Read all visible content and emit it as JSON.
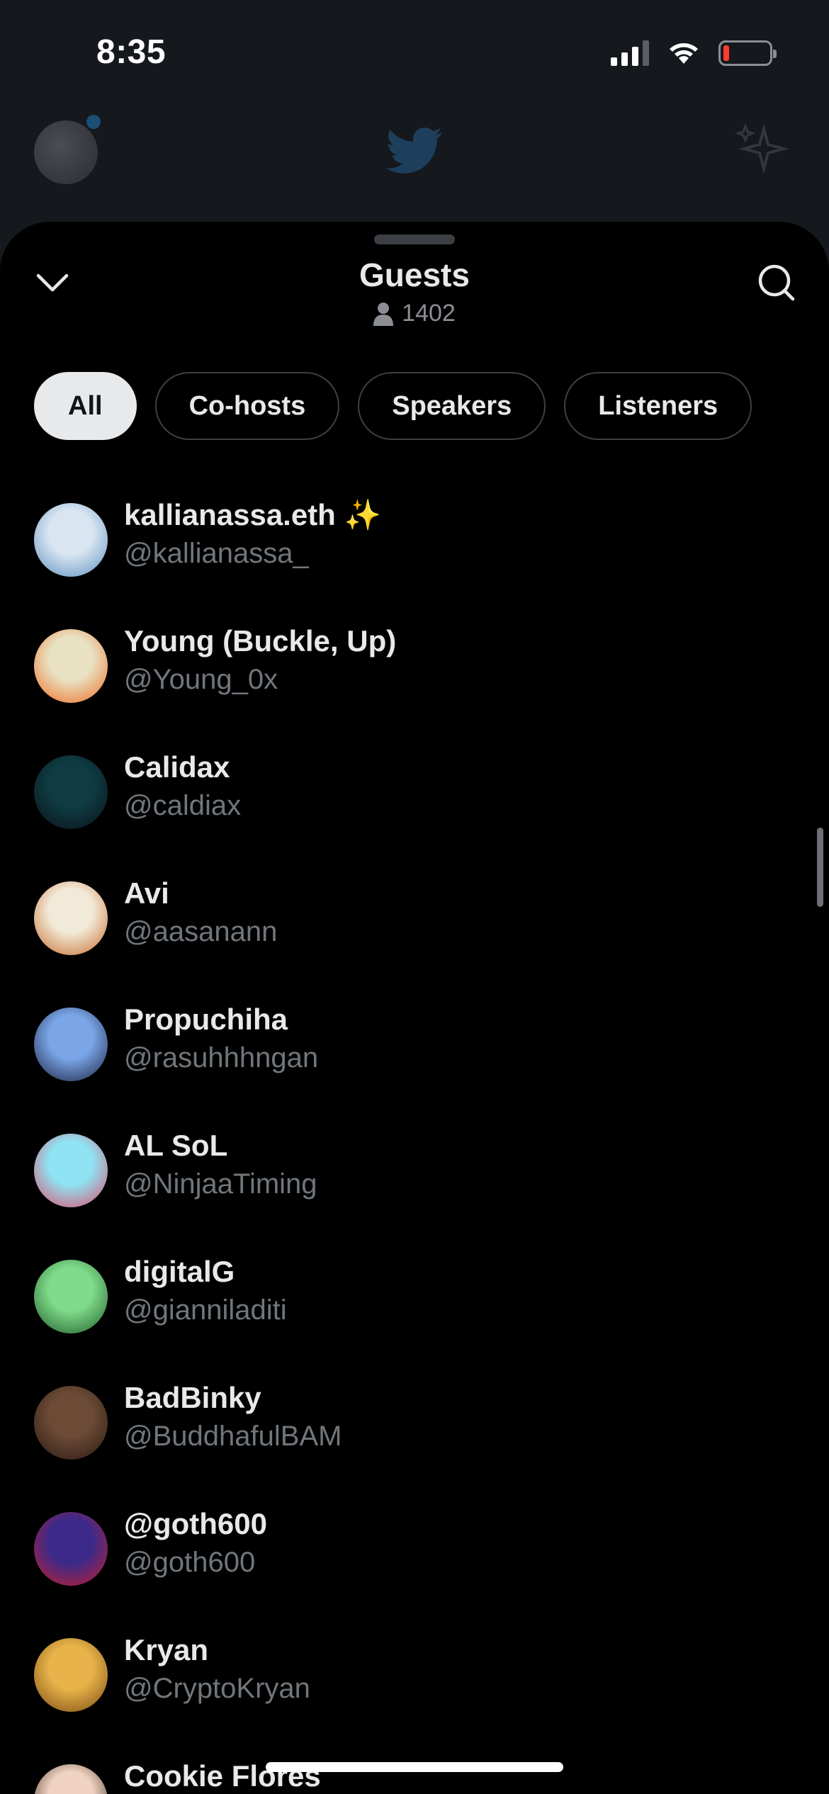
{
  "status_bar": {
    "time": "8:35",
    "icons": [
      "cellular-signal-icon",
      "wifi-icon",
      "battery-low-icon"
    ],
    "battery_color": "#ff3b30"
  },
  "background_header": {
    "icons": [
      "profile-avatar",
      "twitter-bird-icon",
      "sparkle-icon"
    ],
    "accent_color": "#1d9bf0"
  },
  "sheet": {
    "title": "Guests",
    "guest_count": "1402",
    "icons": [
      "chevron-down-icon",
      "search-icon",
      "person-icon"
    ]
  },
  "tabs": [
    {
      "label": "All",
      "active": true
    },
    {
      "label": "Co-hosts",
      "active": false
    },
    {
      "label": "Speakers",
      "active": false
    },
    {
      "label": "Listeners",
      "active": false
    }
  ],
  "guests": [
    {
      "name": "kallianassa.eth",
      "badge": "✨",
      "handle": "@kallianassa_",
      "avatar_colors": [
        "#d9e6f2",
        "#5d8fbf"
      ]
    },
    {
      "name": "Young (Buckle, Up)",
      "handle": "@Young_0x",
      "avatar_colors": [
        "#e8e1c2",
        "#f06a1e"
      ]
    },
    {
      "name": "Calidax",
      "handle": "@caldiax",
      "avatar_colors": [
        "#0f3c44",
        "#0a1216"
      ]
    },
    {
      "name": "Avi",
      "handle": "@aasanann",
      "avatar_colors": [
        "#f2ead8",
        "#c66a2b"
      ]
    },
    {
      "name": "Propuchiha",
      "handle": "@rasuhhhngan",
      "avatar_colors": [
        "#7aa6e8",
        "#1a1f3d"
      ]
    },
    {
      "name": "AL SoL",
      "handle": "@NinjaaTiming",
      "avatar_colors": [
        "#8fe3f2",
        "#e04a6b"
      ]
    },
    {
      "name": "digitalG",
      "handle": "@gianniladiti",
      "avatar_colors": [
        "#7fdc8a",
        "#1f5a2a"
      ]
    },
    {
      "name": "BadBinky",
      "handle": "@BuddhafulBAM",
      "avatar_colors": [
        "#6b4a36",
        "#2a1a12"
      ]
    },
    {
      "name": "@goth600",
      "handle": "@goth600",
      "avatar_colors": [
        "#3b2a8a",
        "#c41d2c"
      ]
    },
    {
      "name": "Kryan",
      "handle": "@CryptoKryan",
      "avatar_colors": [
        "#e7b34a",
        "#7a4a12"
      ]
    },
    {
      "name": "Cookie Flores",
      "handle": "",
      "avatar_colors": [
        "#f0d2c0",
        "#2b1b14"
      ]
    }
  ]
}
